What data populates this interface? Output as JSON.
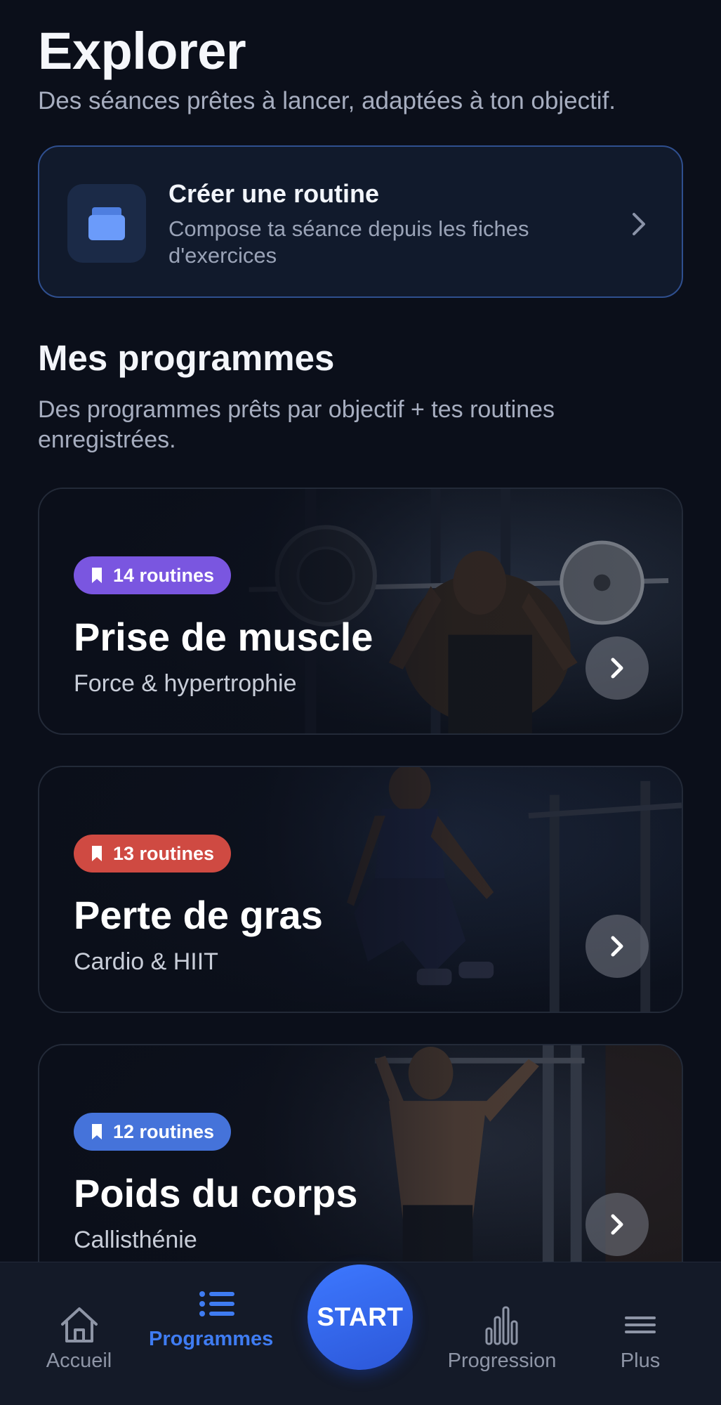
{
  "header": {
    "title": "Explorer",
    "subtitle": "Des séances prêtes à lancer, adaptées à ton objectif."
  },
  "create_routine": {
    "title": "Créer une routine",
    "description": "Compose ta séance depuis les fiches d'exercices",
    "icon": "stacked-cards-icon"
  },
  "programs_section": {
    "title": "Mes programmes",
    "description": "Des programmes prêts par objectif + tes routines enregistrées."
  },
  "programs": [
    {
      "badge": "14 routines",
      "badge_color": "#7a56e0",
      "title": "Prise de muscle",
      "subtitle": "Force & hypertrophie",
      "image": "barbell-press-photo"
    },
    {
      "badge": "13 routines",
      "badge_color": "#cf4a42",
      "title": "Perte de gras",
      "subtitle": "Cardio & HIIT",
      "image": "jumping-athlete-photo"
    },
    {
      "badge": "12 routines",
      "badge_color": "#4573da",
      "title": "Poids du corps",
      "subtitle": "Callisthénie",
      "image": "pull-up-athlete-photo"
    }
  ],
  "bottom_nav": {
    "home": "Accueil",
    "programs": "Programmes",
    "start": "START",
    "progress": "Progression",
    "more": "Plus"
  },
  "colors": {
    "background": "#0b0f1a",
    "accent": "#3f7cf2",
    "card_border": "#2f4f8f"
  }
}
